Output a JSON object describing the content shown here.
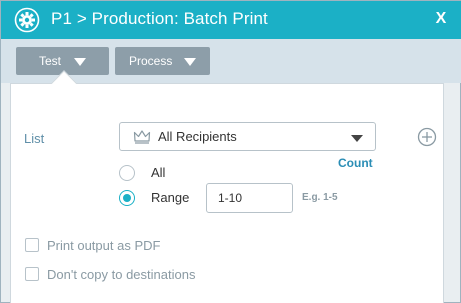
{
  "dialog": {
    "title": "P1 > Production: Batch Print",
    "close_label": "X"
  },
  "tabs": [
    {
      "label": "Test"
    },
    {
      "label": "Process"
    }
  ],
  "form": {
    "list_label": "List",
    "recipients_value": "All Recipients",
    "count_link": "Count",
    "radio_all_label": "All",
    "radio_range_label": "Range",
    "selected_option": "Range",
    "range_value": "1-10",
    "range_hint": "E.g. 1-5",
    "print_pdf_label": "Print output as PDF",
    "print_pdf_checked": false,
    "no_copy_label": "Don't copy to destinations",
    "no_copy_checked": false
  },
  "colors": {
    "accent": "#1bb0c6",
    "tab_button": "#8d9ea9",
    "link": "#2a8db5"
  },
  "icons": {
    "title": "settings-gear-icon",
    "list": "crown-icon",
    "add": "plus-circle-icon"
  }
}
